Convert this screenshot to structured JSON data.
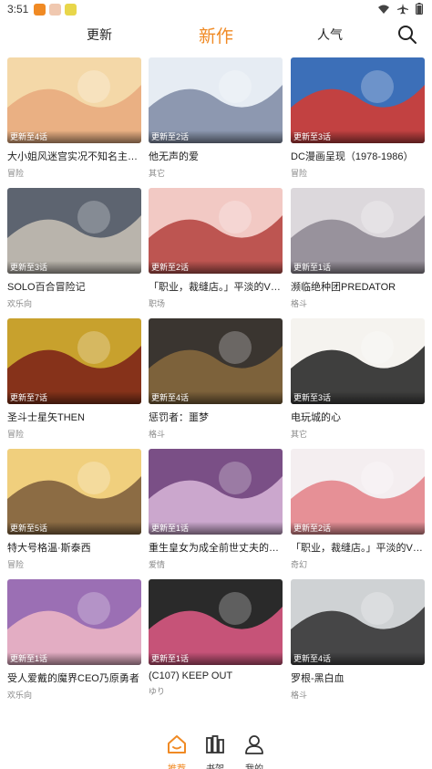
{
  "status": {
    "time": "3:51"
  },
  "nav": {
    "tabs": [
      {
        "label": "更新"
      },
      {
        "label": "新作"
      },
      {
        "label": "人气"
      }
    ]
  },
  "comics": [
    {
      "title": "大小姐风迷宫实况不知名主播…",
      "genre": "冒险",
      "badge": "更新至4话"
    },
    {
      "title": "他无声的爱",
      "genre": "其它",
      "badge": "更新至2话"
    },
    {
      "title": "DC漫画呈现（1978-1986）",
      "genre": "冒险",
      "badge": "更新至3话"
    },
    {
      "title": "SOLO百合冒险记",
      "genre": "欢乐向",
      "badge": "更新至3话"
    },
    {
      "title": "「职业，裁缝店。」平淡的VR…",
      "genre": "职场",
      "badge": "更新至2话"
    },
    {
      "title": "濒临绝种团PREDATOR",
      "genre": "格斗",
      "badge": "更新至1话"
    },
    {
      "title": "圣斗士星矢THEN",
      "genre": "冒险",
      "badge": "更新至7话"
    },
    {
      "title": "惩罚者：噩梦",
      "genre": "格斗",
      "badge": "更新至4话"
    },
    {
      "title": "电玩城的心",
      "genre": "其它",
      "badge": "更新至3话"
    },
    {
      "title": "特大号格温·斯泰西",
      "genre": "冒险",
      "badge": "更新至5话"
    },
    {
      "title": "重生皇女为成全前世丈夫的初…",
      "genre": "爱情",
      "badge": "更新至1话"
    },
    {
      "title": "「职业，裁缝店。」平淡的VR…",
      "genre": "奇幻",
      "badge": "更新至2话"
    },
    {
      "title": "受人爱戴的魔界CEO乃原勇者",
      "genre": "欢乐向",
      "badge": "更新至1话"
    },
    {
      "title": "(C107) KEEP OUT",
      "genre": "ゆり",
      "badge": "更新至1话"
    },
    {
      "title": "罗根-黑白血",
      "genre": "格斗",
      "badge": "更新至4话"
    },
    {
      "title": "",
      "genre": "",
      "badge": ""
    },
    {
      "title": "",
      "genre": "",
      "badge": ""
    },
    {
      "title": "",
      "genre": "",
      "badge": ""
    }
  ],
  "cover_colors": [
    [
      "#f4d8a8",
      "#e8a97c"
    ],
    [
      "#e6ecf3",
      "#7d8aa3"
    ],
    [
      "#3c6fb8",
      "#d93a2b"
    ],
    [
      "#5d6470",
      "#c9c2b6"
    ],
    [
      "#f2c9c4",
      "#b4413d"
    ],
    [
      "#dcd8dc",
      "#8c8690"
    ],
    [
      "#c8a12d",
      "#7a1f18"
    ],
    [
      "#3a3530",
      "#8a6a3d"
    ],
    [
      "#f5f3ef",
      "#1f1f1f"
    ],
    [
      "#f0cf7d",
      "#7a5a3a"
    ],
    [
      "#7a4f86",
      "#d9b6d9"
    ],
    [
      "#f4eef0",
      "#e37f86"
    ],
    [
      "#9b6fb4",
      "#f0b8c6"
    ],
    [
      "#2a2a2a",
      "#e25b86"
    ],
    [
      "#cfd2d4",
      "#2e2e2e"
    ],
    [
      "#e8b8a5",
      "#a84c3e"
    ],
    [
      "#e9b7b6",
      "#7d5a58"
    ],
    [
      "#b5d1f0",
      "#7a8fd1"
    ]
  ],
  "bottom_nav": [
    {
      "label": "推荐",
      "icon": "home-icon",
      "active": true
    },
    {
      "label": "书架",
      "icon": "bookshelf-icon",
      "active": false
    },
    {
      "label": "我的",
      "icon": "user-icon",
      "active": false
    }
  ],
  "colors": {
    "accent": "#f08a24",
    "text": "#222222",
    "muted": "#888888"
  }
}
